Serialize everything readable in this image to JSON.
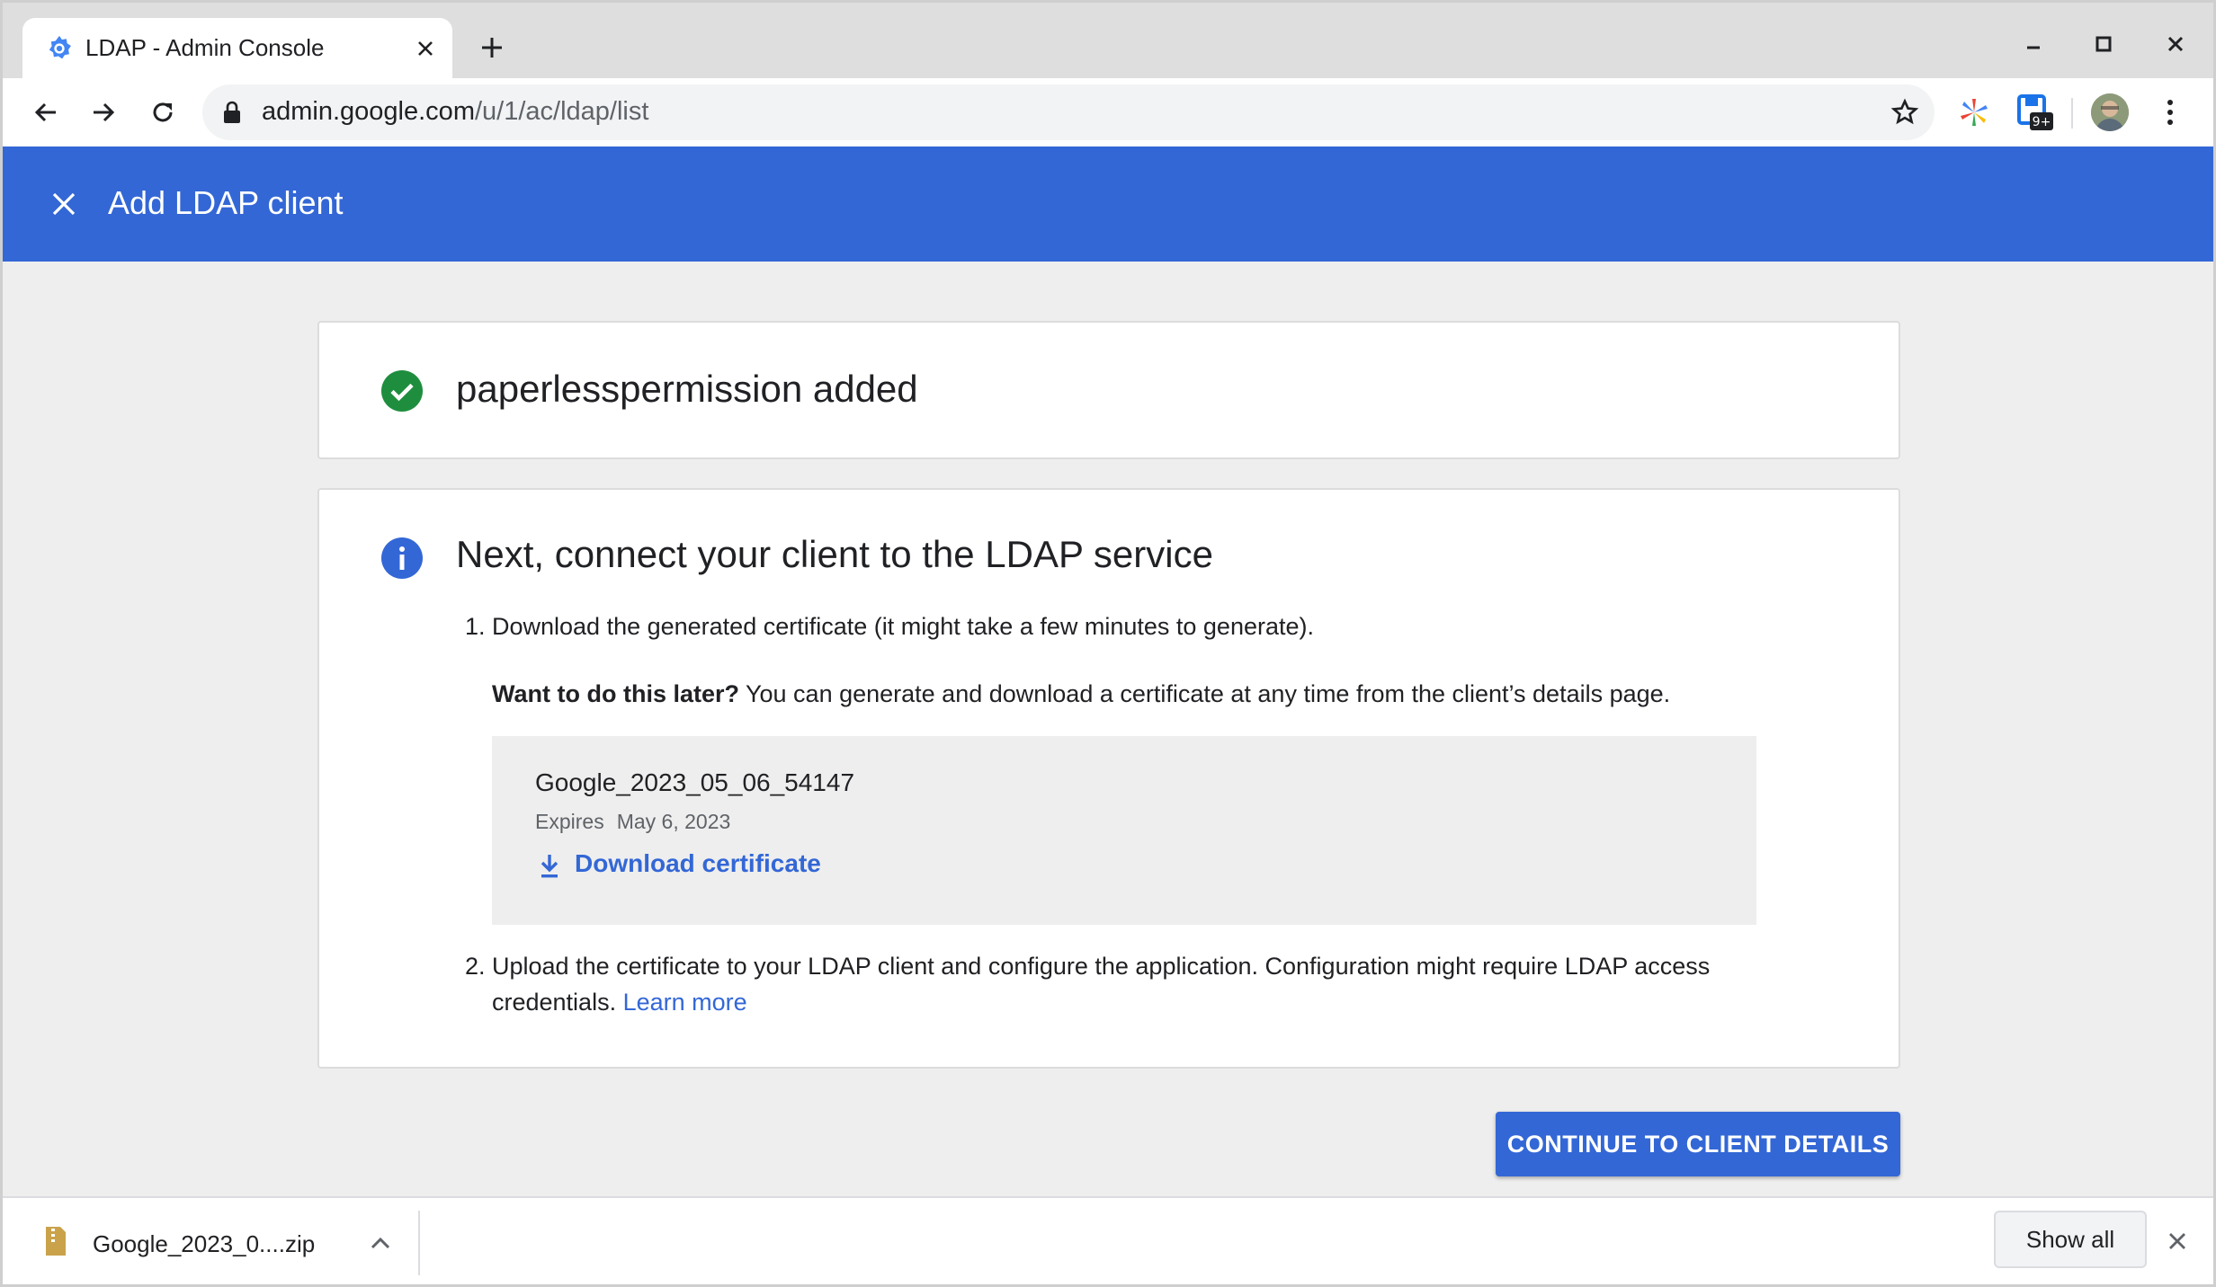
{
  "browser": {
    "tab_title": "LDAP - Admin Console",
    "url_host": "admin.google.com",
    "url_path": "/u/1/ac/ldap/list",
    "extension_badge": "9+",
    "icons": [
      "favicon-admin-icon",
      "close-icon",
      "plus-icon",
      "minimize-icon",
      "maximize-icon",
      "back-icon",
      "forward-icon",
      "reload-icon",
      "lock-icon",
      "star-icon",
      "extension-icon",
      "avatar",
      "more-vert-icon"
    ]
  },
  "header": {
    "title": "Add LDAP client",
    "color": "#3367d6"
  },
  "success_card": {
    "title": "paperlesspermission added",
    "icon": "check-circle-icon",
    "icon_color": "#1e8e3e"
  },
  "next_card": {
    "title": "Next, connect your client to the LDAP service",
    "icon": "info-icon",
    "step1_num": "1.",
    "step1_text": "Download the generated certificate (it might take a few minutes to generate).",
    "later_bold": "Want to do this later?",
    "later_text": " You can generate and download a certificate at any time from the client’s details page.",
    "certificate": {
      "name": "Google_2023_05_06_54147",
      "expires_label": "Expires",
      "expires_value": "May 6, 2023",
      "download_label": "Download certificate"
    },
    "step2_num": "2.",
    "step2_text": "Upload the certificate to your LDAP client and configure the application. Configuration might require LDAP access credentials. ",
    "learn_more": "Learn more"
  },
  "actions": {
    "continue_label": "CONTINUE TO CLIENT DETAILS"
  },
  "download_shelf": {
    "file_name": "Google_2023_0....zip",
    "show_all_label": "Show all"
  }
}
